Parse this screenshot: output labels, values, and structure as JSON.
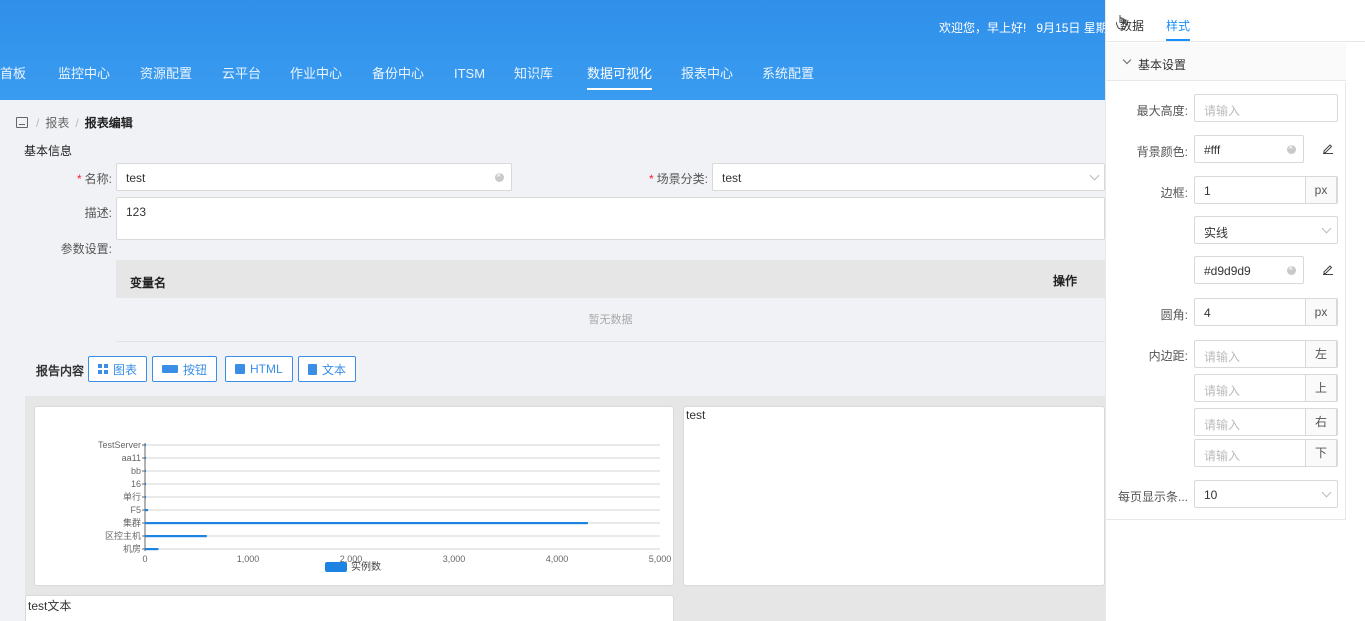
{
  "header": {
    "welcome": "欢迎您，早上好!",
    "date": "9月15日 星期",
    "nav": [
      {
        "label": "首板",
        "active": false
      },
      {
        "label": "监控中心",
        "active": false
      },
      {
        "label": "资源配置",
        "active": false
      },
      {
        "label": "云平台",
        "active": false
      },
      {
        "label": "作业中心",
        "active": false
      },
      {
        "label": "备份中心",
        "active": false
      },
      {
        "label": "ITSM",
        "active": false
      },
      {
        "label": "知识库",
        "active": false
      },
      {
        "label": "数据可视化",
        "active": true
      },
      {
        "label": "报表中心",
        "active": false
      },
      {
        "label": "系统配置",
        "active": false
      }
    ]
  },
  "breadcrumb": {
    "items": [
      "报表",
      "报表编辑"
    ],
    "separator": "/"
  },
  "form": {
    "section_title": "基本信息",
    "name_label": "名称:",
    "name_value": "test",
    "scene_label": "场景分类:",
    "scene_value": "test",
    "desc_label": "描述:",
    "desc_value": "123",
    "params_label": "参数设置:",
    "params_table": {
      "columns": [
        "变量名",
        "操作"
      ],
      "empty_text": "暂无数据"
    }
  },
  "report": {
    "label": "报告内容",
    "buttons": [
      {
        "label": "图表",
        "icon": "grid-icon"
      },
      {
        "label": "按钮",
        "icon": "btn-icon"
      },
      {
        "label": "HTML",
        "icon": "html-icon"
      },
      {
        "label": "文本",
        "icon": "doc-icon"
      }
    ],
    "text_card_1": "test",
    "text_card_2": "test文本"
  },
  "chart_data": {
    "type": "bar",
    "orientation": "horizontal",
    "categories": [
      "TestServer",
      "aa11",
      "bb",
      "16",
      "单行",
      "F5",
      "集群",
      "区控主机",
      "机房"
    ],
    "series": [
      {
        "name": "实例数",
        "values": [
          5,
          2,
          3,
          2,
          1,
          30,
          4300,
          600,
          130
        ],
        "color": "#1c84e0"
      }
    ],
    "xlim": [
      0,
      5000
    ],
    "xticks": [
      "0",
      "1,000",
      "2,000",
      "3,000",
      "4,000",
      "5,000"
    ],
    "legend": "bottom",
    "grid": true
  },
  "panel": {
    "tabs": [
      {
        "label": "数据",
        "active": false
      },
      {
        "label": "样式",
        "active": true
      }
    ],
    "section": "基本设置",
    "fields": {
      "max_height_label": "最大高度:",
      "max_height_placeholder": "请输入",
      "bg_color_label": "背景颜色:",
      "bg_color_value": "#fff",
      "border_label": "边框:",
      "border_width": "1",
      "border_unit": "px",
      "border_style": "实线",
      "border_color": "#d9d9d9",
      "radius_label": "圆角:",
      "radius_value": "4",
      "radius_unit": "px",
      "padding_label": "内边距:",
      "padding_placeholder": "请输入",
      "padding_left": "左",
      "padding_top": "上",
      "padding_right": "右",
      "padding_bottom": "下",
      "page_size_label": "每页显示条...",
      "page_size_value": "10"
    }
  }
}
